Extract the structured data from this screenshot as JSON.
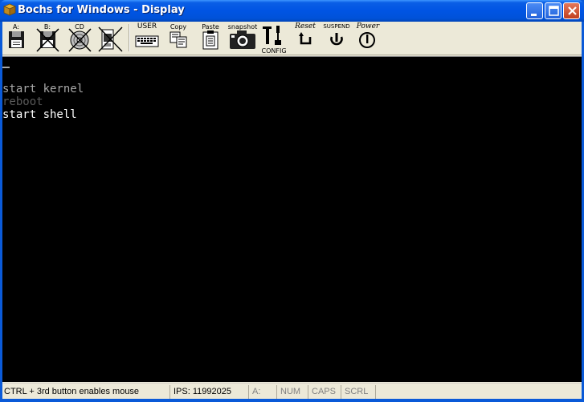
{
  "window": {
    "title": "Bochs for Windows - Display"
  },
  "toolbar": {
    "floppy_a": "A:",
    "floppy_b": "B:",
    "cdrom": "CD",
    "user": "USER",
    "copy": "Copy",
    "paste": "Paste",
    "snapshot": "snapshot",
    "config": "CONFIG",
    "reset": "Reset",
    "suspend": "SUSPEND",
    "power": "Power"
  },
  "display": {
    "lines": [
      {
        "text": "start kernel",
        "color": "#a8a8a8"
      },
      {
        "text": "reboot",
        "color": "#5a5a5a"
      },
      {
        "text": "start shell",
        "color": "#ffffff"
      }
    ]
  },
  "status": {
    "mouse_hint": "CTRL + 3rd button enables mouse",
    "ips": "IPS:  11992025",
    "drive": "A:",
    "num": "NUM",
    "caps": "CAPS",
    "scrl": "SCRL"
  }
}
